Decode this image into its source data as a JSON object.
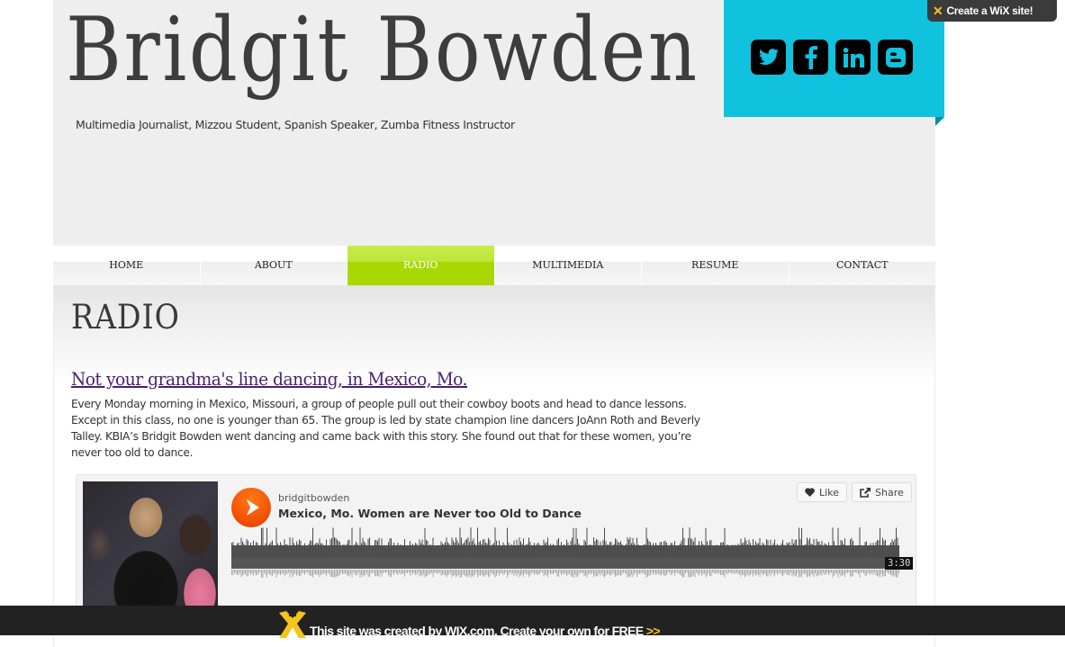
{
  "header": {
    "site_title": "Bridgit Bowden",
    "tagline": "Multimedia Journalist, Mizzou Student, Spanish Speaker, Zumba Fitness Instructor",
    "accent_color": "#10c2de"
  },
  "social": [
    {
      "name": "twitter",
      "icon": "twitter-icon"
    },
    {
      "name": "facebook",
      "icon": "facebook-icon"
    },
    {
      "name": "linkedin",
      "icon": "linkedin-icon"
    },
    {
      "name": "blogger",
      "icon": "blogger-icon"
    }
  ],
  "wix_badge": {
    "label": "Create a WiX site!"
  },
  "nav": {
    "active": "RADIO",
    "active_color": "#a8d800",
    "items": [
      {
        "label": "HOME"
      },
      {
        "label": "ABOUT"
      },
      {
        "label": "RADIO"
      },
      {
        "label": "MULTIMEDIA"
      },
      {
        "label": "RESUME"
      },
      {
        "label": "CONTACT"
      }
    ]
  },
  "main": {
    "page_heading": "RADIO",
    "story": {
      "title": "Not your grandma's line dancing, in Mexico, Mo.",
      "body": "Every Monday morning in Mexico, Missouri, a group of people pull out their cowboy boots and head to dance lessons. Except in this class, no one is younger than 65. The group is led by state champion line dancers JoAnn Roth and Beverly Talley. KBIA’s Bridgit Bowden went dancing and came back with this story. She found out that for these women, you’re never too old to dance."
    }
  },
  "player": {
    "user": "bridgitbowden",
    "track_title": "Mexico, Mo. Women are Never too Old to Dance",
    "like_label": "Like",
    "share_label": "Share",
    "duration": "3:30",
    "play_color": "#f04d00"
  },
  "wix_bar": {
    "text": "This site was created by WIX.com. Create your own for FREE",
    "arrows": ">>"
  }
}
